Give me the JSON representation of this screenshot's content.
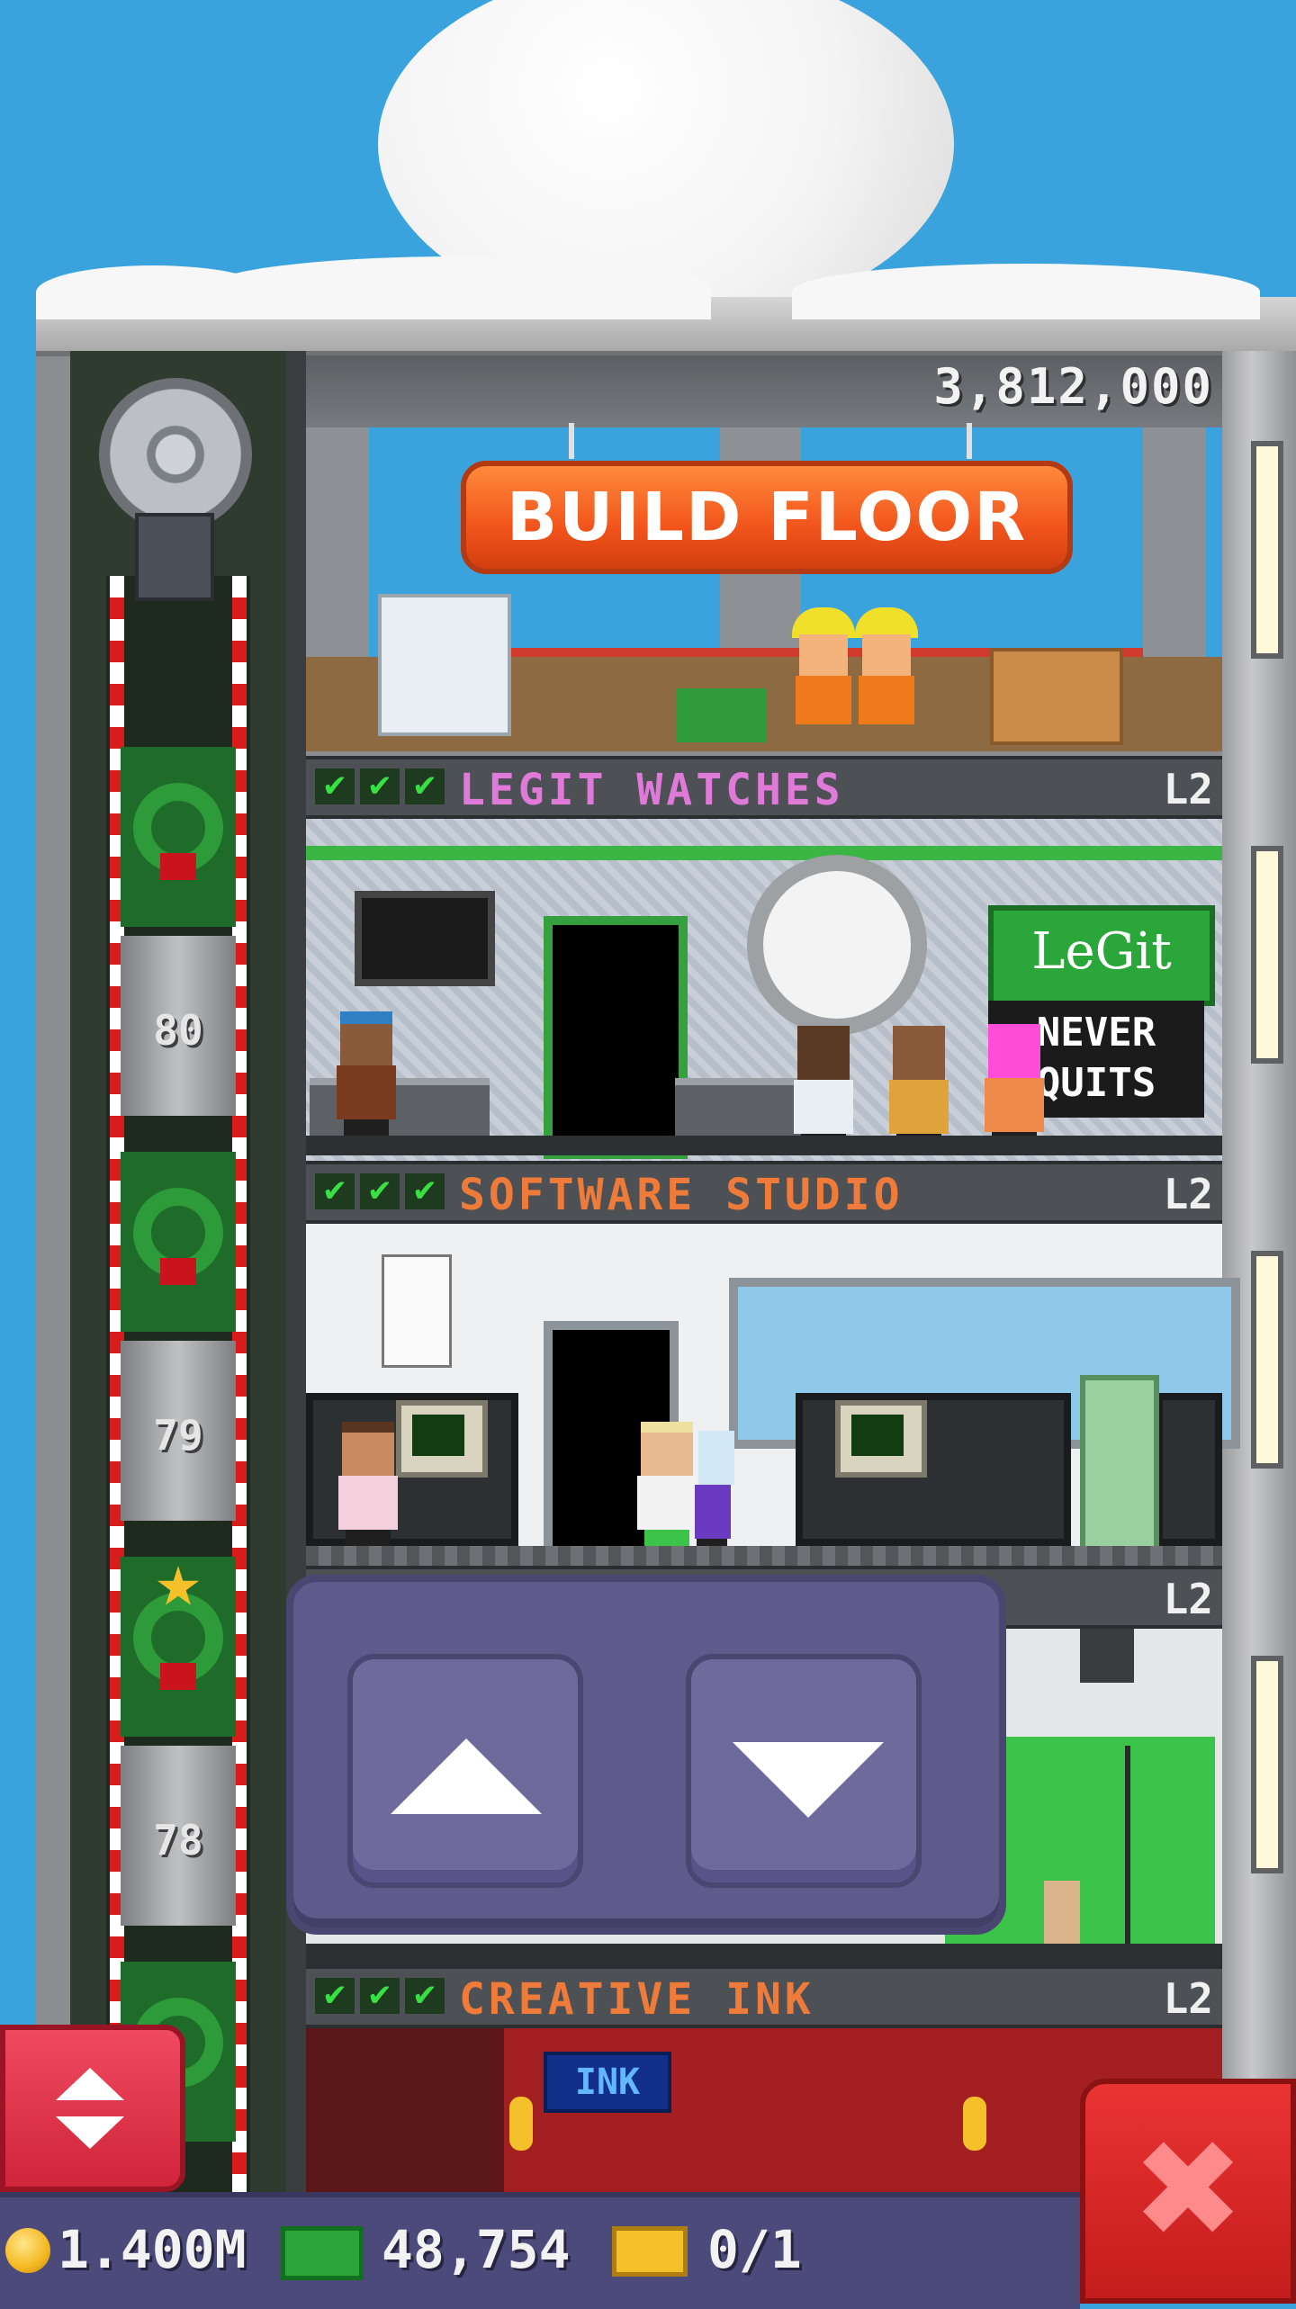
{
  "build_floor": {
    "cost": "3,812,000",
    "button_label": "BUILD FLOOR"
  },
  "elevator": {
    "floor_numbers": [
      "80",
      "79",
      "78"
    ]
  },
  "floors": [
    {
      "name": "LEGIT WATCHES",
      "level": "L2",
      "checks": [
        "✔",
        "✔",
        "✔"
      ],
      "name_color": "#e07ad8"
    },
    {
      "name": "SOFTWARE STUDIO",
      "level": "L2",
      "checks": [
        "✔",
        "✔",
        "✔"
      ],
      "name_color": "#ef7b3a"
    },
    {
      "name": "",
      "level": "L2",
      "checks": [
        "✔"
      ],
      "name_color": "#ef7b3a"
    },
    {
      "name": "CREATIVE INK",
      "level": "L2",
      "checks": [
        "✔",
        "✔",
        "✔"
      ],
      "name_color": "#ef7b3a"
    }
  ],
  "signs": {
    "legit": "LeGit",
    "never_line1": "NEVER",
    "never_line2": "QUITS",
    "ink": "INK"
  },
  "popup": {
    "up_icon": "arrow-up-icon",
    "down_icon": "arrow-down-icon"
  },
  "status": {
    "coins": "1.400M",
    "cash": "48,754",
    "bux": "0/1"
  },
  "buttons": {
    "close_label": "✖"
  },
  "colors": {
    "build_sign": "#f2541b",
    "check_green": "#39e043",
    "popup_purple": "#5e5a8c",
    "close_red": "#d0243a"
  }
}
